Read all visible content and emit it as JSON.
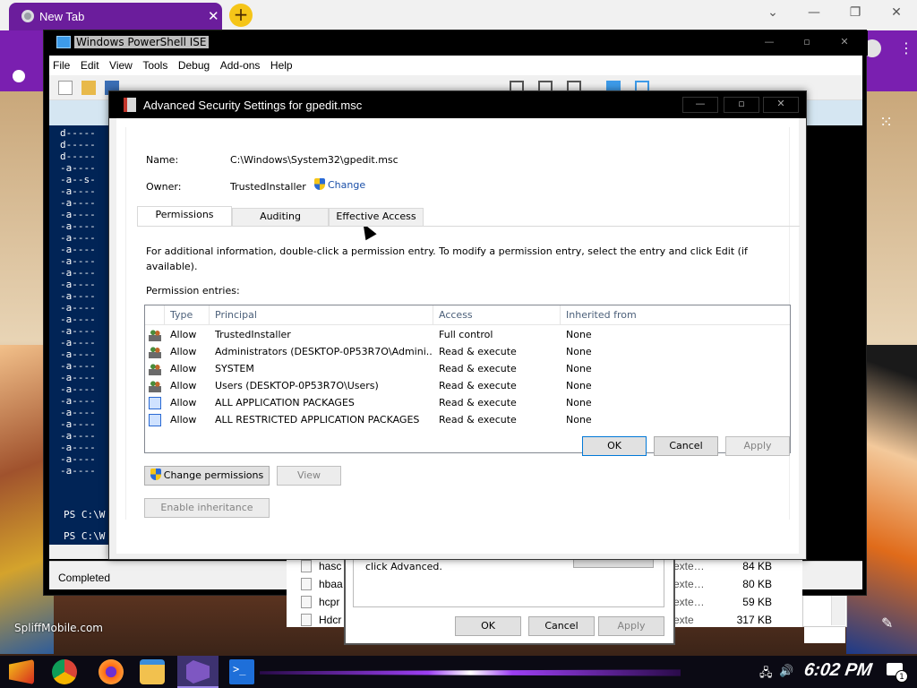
{
  "chrome": {
    "tab_title": "New Tab",
    "tab_close": "✕",
    "new_tab": "+",
    "minimize": "⌄",
    "min": "—",
    "restore": "❐",
    "close": "✕",
    "menu": "⋮",
    "apps": "⋮⋮⋮"
  },
  "ise": {
    "title": "Windows PowerShell ISE",
    "menu": [
      "File",
      "Edit",
      "View",
      "Tools",
      "Debug",
      "Add-ons",
      "Help"
    ],
    "console_lines": [
      "d-----",
      "d-----",
      "d-----",
      "-a----",
      "-a--s-",
      "-a----",
      "-a----",
      "-a----",
      "-a----",
      "-a----",
      "-a----",
      "-a----",
      "-a----",
      "-a----",
      "-a----",
      "-a----",
      "-a----",
      "-a----",
      "-a----",
      "-a----",
      "-a----",
      "-a----",
      "-a----",
      "-a----",
      "-a----",
      "-a----",
      "-a----",
      "-a----",
      "-a----",
      "-a----"
    ],
    "prompt1": "PS C:\\W",
    "prompt2": "PS C:\\W",
    "status": "Completed"
  },
  "background": {
    "props_text": "click Advanced.",
    "ok": "OK",
    "cancel": "Cancel",
    "apply": "Apply",
    "help": "?",
    "files": [
      {
        "name": "hasc",
        "type": "exte…",
        "size": "84 KB"
      },
      {
        "name": "hbaa",
        "type": "exte…",
        "size": "80 KB"
      },
      {
        "name": "hcpr",
        "type": "exte…",
        "size": "59 KB"
      },
      {
        "name": "Hdcr",
        "type": "exte",
        "size": "317 KB"
      }
    ],
    "watermark": "SpliffMobile.com"
  },
  "dialog": {
    "title": "Advanced Security Settings for gpedit.msc",
    "min": "—",
    "max": "▫",
    "close": "✕",
    "name_label": "Name:",
    "name_value": "C:\\Windows\\System32\\gpedit.msc",
    "owner_label": "Owner:",
    "owner_value": "TrustedInstaller",
    "change_link": "Change",
    "tabs": [
      "Permissions",
      "Auditing",
      "Effective Access"
    ],
    "info_text": "For additional information, double-click a permission entry. To modify a permission entry, select the entry and click Edit (if available).",
    "entries_label": "Permission entries:",
    "columns": [
      "Type",
      "Principal",
      "Access",
      "Inherited from"
    ],
    "entries": [
      {
        "type": "Allow",
        "principal": "TrustedInstaller",
        "access": "Full control",
        "inherited": "None",
        "icon": "people"
      },
      {
        "type": "Allow",
        "principal": "Administrators (DESKTOP-0P53R7O\\Admini...",
        "access": "Read & execute",
        "inherited": "None",
        "icon": "people"
      },
      {
        "type": "Allow",
        "principal": "SYSTEM",
        "access": "Read & execute",
        "inherited": "None",
        "icon": "people"
      },
      {
        "type": "Allow",
        "principal": "Users (DESKTOP-0P53R7O\\Users)",
        "access": "Read & execute",
        "inherited": "None",
        "icon": "people"
      },
      {
        "type": "Allow",
        "principal": "ALL APPLICATION PACKAGES",
        "access": "Read & execute",
        "inherited": "None",
        "icon": "pkg"
      },
      {
        "type": "Allow",
        "principal": "ALL RESTRICTED APPLICATION PACKAGES",
        "access": "Read & execute",
        "inherited": "None",
        "icon": "pkg"
      }
    ],
    "change_permissions": "Change permissions",
    "view": "View",
    "enable_inheritance": "Enable inheritance",
    "ok": "OK",
    "cancel": "Cancel",
    "apply": "Apply"
  },
  "taskbar": {
    "clock": "6:02 PM",
    "notification_count": "1",
    "network_icon": "🖧",
    "volume_icon": "🔊"
  }
}
